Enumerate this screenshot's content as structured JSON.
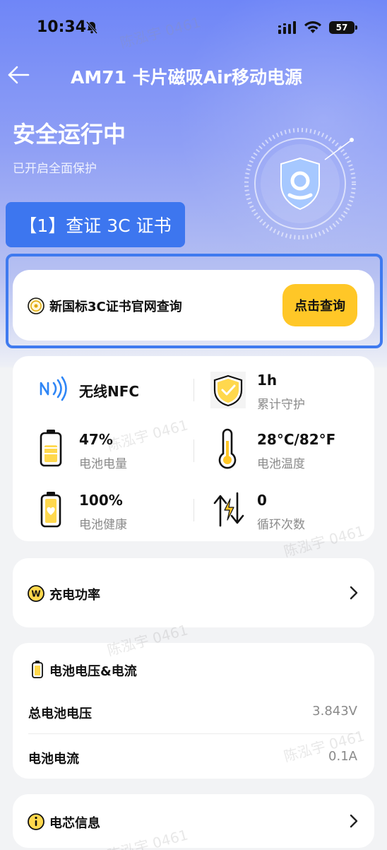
{
  "status_bar": {
    "time": "10:34",
    "battery": "57"
  },
  "nav": {
    "title": "AM71 卡片磁吸Air移动电源"
  },
  "hero": {
    "title": "安全运行中",
    "subtitle": "已开启全面保护",
    "step_button": "【1】查证 3C 证书"
  },
  "cert": {
    "label": "新国标3C证书官网查询",
    "button": "点击查询"
  },
  "stats": {
    "nfc": {
      "label": "无线NFC"
    },
    "guard": {
      "value": "1h",
      "label": "累计守护"
    },
    "battery_level": {
      "value": "47%",
      "label": "电池电量",
      "percent": 47
    },
    "temperature": {
      "value": "28°C/82°F",
      "label": "电池温度"
    },
    "health": {
      "value": "100%",
      "label": "电池健康"
    },
    "cycles": {
      "value": "0",
      "label": "循环次数"
    }
  },
  "charge_power": {
    "title": "充电功率"
  },
  "voltage_current": {
    "title": "电池电压&电流",
    "rows": [
      {
        "label": "总电池电压",
        "value": "3.843V"
      },
      {
        "label": "电池电流",
        "value": "0.1A"
      }
    ]
  },
  "cell_info": {
    "title": "电芯信息"
  },
  "watermark": "陈泓宇 0461",
  "colors": {
    "accent": "#3d76ef",
    "highlight": "#ffc727",
    "icon_blue": "#2f86f6"
  }
}
